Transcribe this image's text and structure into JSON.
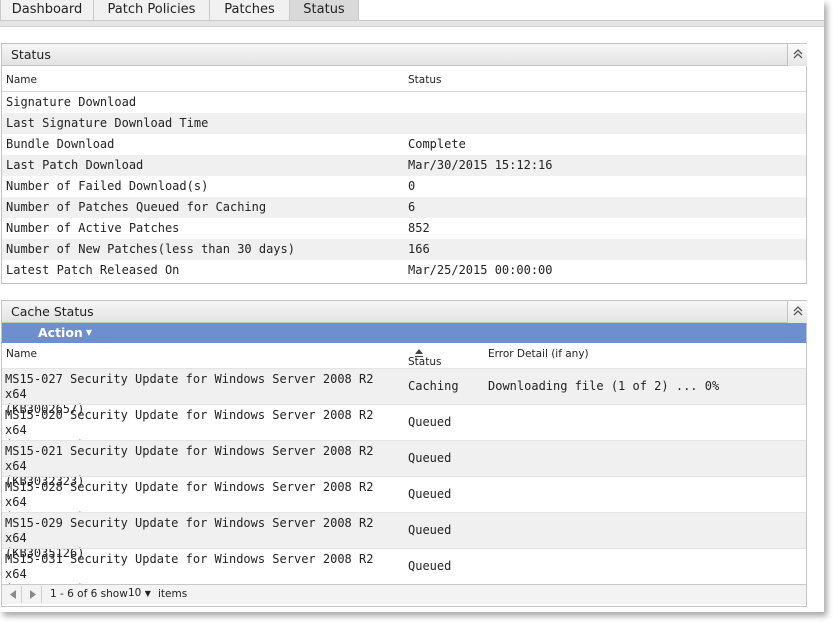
{
  "tabs": [
    {
      "label": "Dashboard",
      "active": false
    },
    {
      "label": "Patch Policies",
      "active": false
    },
    {
      "label": "Patches",
      "active": false
    },
    {
      "label": "Status",
      "active": true
    }
  ],
  "status_panel": {
    "title": "Status",
    "col_name": "Name",
    "col_status": "Status",
    "rows": [
      {
        "name": "Signature Download",
        "value": ""
      },
      {
        "name": "Last Signature Download Time",
        "value": ""
      },
      {
        "name": "Bundle Download",
        "value": "Complete"
      },
      {
        "name": "Last Patch Download",
        "value": "Mar/30/2015 15:12:16"
      },
      {
        "name": "Number of Failed Download(s)",
        "value": "0"
      },
      {
        "name": "Number of Patches Queued for Caching",
        "value": "6"
      },
      {
        "name": "Number of Active Patches",
        "value": "852"
      },
      {
        "name": "Number of New Patches(less than 30 days)",
        "value": "166"
      },
      {
        "name": "Latest Patch Released On",
        "value": "Mar/25/2015 00:00:00"
      }
    ]
  },
  "cache_panel": {
    "title": "Cache Status",
    "action_label": "Action",
    "col_name": "Name",
    "col_status": "Status",
    "col_error": "Error Detail (if any)",
    "rows": [
      {
        "name_line1": "MS15-027 Security Update for Windows Server 2008 R2 x64",
        "name_line2": "(KB3002657)",
        "status": "Caching",
        "error": "Downloading file (1 of 2) ... 0%"
      },
      {
        "name_line1": "MS15-020 Security Update for Windows Server 2008 R2 x64",
        "name_line2": "(KB3039066)",
        "status": "Queued",
        "error": ""
      },
      {
        "name_line1": "MS15-021 Security Update for Windows Server 2008 R2 x64",
        "name_line2": "(KB3032323)",
        "status": "Queued",
        "error": ""
      },
      {
        "name_line1": "MS15-028 Security Update for Windows Server 2008 R2 x64",
        "name_line2": "(KB3030377)",
        "status": "Queued",
        "error": ""
      },
      {
        "name_line1": "MS15-029 Security Update for Windows Server 2008 R2 x64",
        "name_line2": "(KB3035126)",
        "status": "Queued",
        "error": ""
      },
      {
        "name_line1": "MS15-031 Security Update for Windows Server 2008 R2 x64",
        "name_line2": "(KB3046049)",
        "status": "Queued",
        "error": ""
      }
    ],
    "pager": {
      "info": "1 - 6 of 6 show",
      "page_size": "10",
      "items_label": "items"
    }
  },
  "colors": {
    "action_bar": "#6d8fd0",
    "row_alt": "#f0f0f0",
    "tab_active": "#d9d9d9"
  }
}
